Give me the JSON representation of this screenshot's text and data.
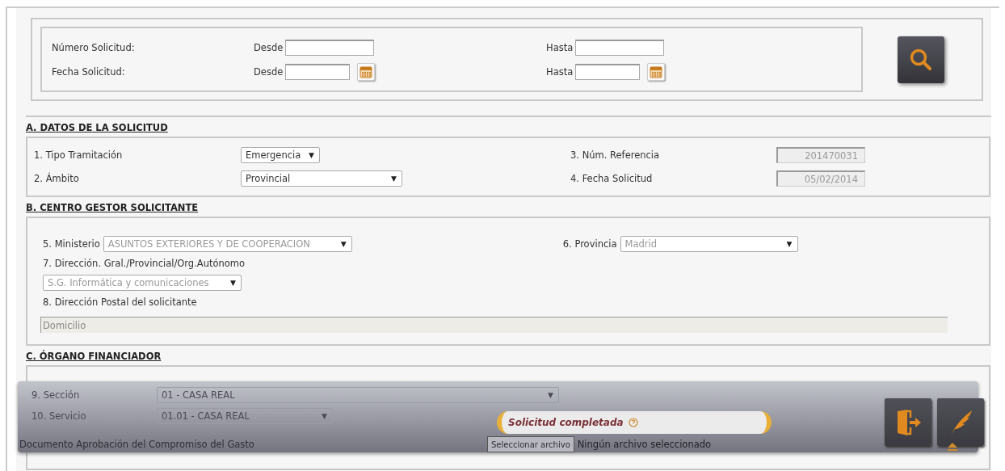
{
  "dropdown_caret": "▼",
  "search": {
    "rows": [
      {
        "label": "Número Solicitud:",
        "from_label": "Desde",
        "to_label": "Hasta",
        "calendar": false
      },
      {
        "label": "Fecha Solicitud:",
        "from_label": "Desde",
        "to_label": "Hasta",
        "calendar": true
      }
    ]
  },
  "section_a": {
    "title": "A. DATOS DE LA SOLICITUD",
    "left": [
      {
        "label": "1. Tipo Tramitación",
        "value": "Emergencia",
        "wide": false
      },
      {
        "label": "2. Ámbito",
        "value": "Provincial",
        "wide": true
      }
    ],
    "right": [
      {
        "label": "3. Núm. Referencia",
        "value": "201470031"
      },
      {
        "label": "4. Fecha Solicitud",
        "value": "05/02/2014"
      }
    ]
  },
  "section_b": {
    "title": "B. CENTRO GESTOR SOLICITANTE",
    "ministerio": {
      "label": "5. Ministerio",
      "value": "ASUNTOS EXTERIORES Y DE COOPERACION",
      "disabled": true
    },
    "provincia": {
      "label": "6. Provincia",
      "value": "Madrid",
      "disabled": true
    },
    "direccion": {
      "label": "7. Dirección. Gral./Provincial/Org.Autónomo",
      "value": "S.G. Informática y comunicaciones",
      "disabled": true
    },
    "postal": {
      "label": "8. Dirección Postal del solicitante",
      "placeholder": "Domicilio"
    }
  },
  "section_c": {
    "title": "C. ÓRGANO FINANCIADOR",
    "rows": [
      {
        "label": "9. Sección",
        "value": "01 - CASA REAL",
        "wide": true
      },
      {
        "label": "10. Servicio",
        "value": "01.01 - CASA REAL",
        "wide": false
      }
    ],
    "document_label": "Documento Aprobación del Compromiso del Gasto",
    "file_button": "Seleccionar archivo",
    "file_status": "Ningún archivo seleccionado"
  },
  "status": {
    "text": "Solicitud completada"
  }
}
